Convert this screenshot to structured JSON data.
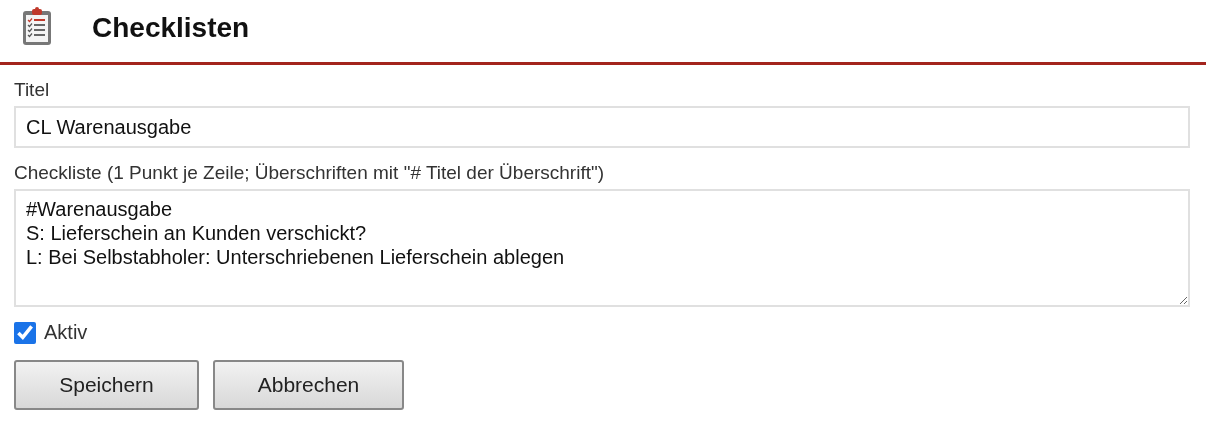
{
  "header": {
    "title": "Checklisten"
  },
  "fields": [
    {
      "label": "Titel",
      "value": "CL Warenausgabe"
    }
  ],
  "checklist": {
    "label": "Checkliste (1 Punkt je Zeile; Überschriften mit \"# Titel der Überschrift\")",
    "value": "#Warenausgabe\nS: Lieferschein an Kunden verschickt?\nL: Bei Selbstabholer: Unterschriebenen Lieferschein ablegen"
  },
  "active": {
    "label": "Aktiv",
    "checked": true
  },
  "buttons": [
    "Speichern",
    "Abbrechen"
  ]
}
